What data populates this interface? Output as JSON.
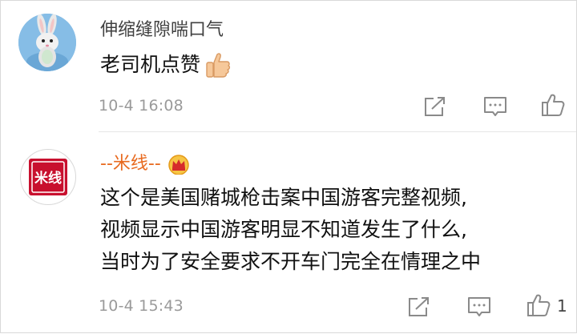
{
  "comments": [
    {
      "username": "伸缩缝隙喘口气",
      "text": "老司机点赞",
      "time": "10-4 16:08",
      "avatar_icon": "rabbit-avatar",
      "emoji": "thumbs-up-emoji"
    },
    {
      "username": "--米线--",
      "badge_icon": "crown-badge-icon",
      "avatar_icon": "seal-stamp-avatar",
      "avatar_text": "米线",
      "lines": [
        "这个是美国赌城枪击案中国游客完整视频,",
        "视频显示中国游客明显不知道发生了什么,",
        "当时为了安全要求不开车门完全在情理之中"
      ],
      "time": "10-4 15:43",
      "like_count": "1"
    }
  ],
  "colors": {
    "username_highlight": "#e86a1f",
    "time_gray": "#9a9a9a",
    "seal_red": "#c8102e"
  }
}
